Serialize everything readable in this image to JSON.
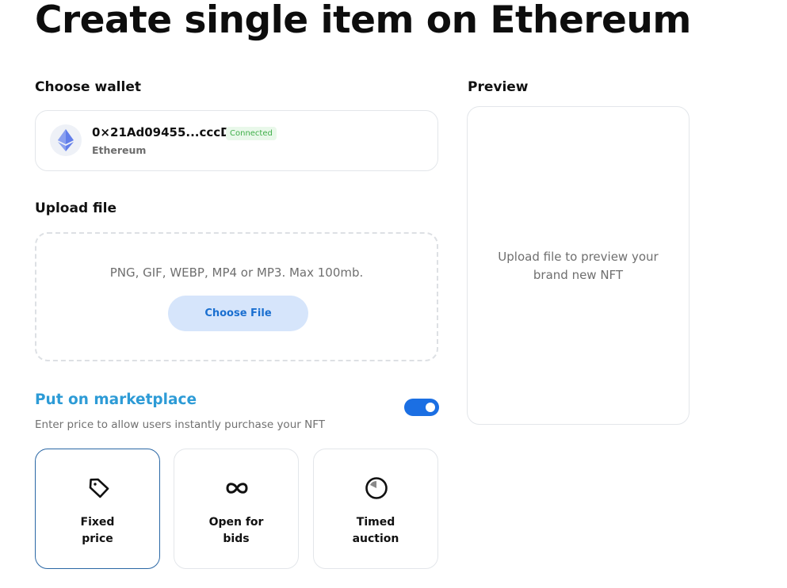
{
  "page": {
    "title": "Create single item on Ethereum"
  },
  "wallet": {
    "label": "Choose wallet",
    "address": "0×21Ad09455...cccD",
    "status": "Connected",
    "network": "Ethereum",
    "icon": "ethereum-icon"
  },
  "upload": {
    "label": "Upload file",
    "hint": "PNG, GIF, WEBP, MP4 or MP3. Max 100mb.",
    "button": "Choose File"
  },
  "marketplace": {
    "title": "Put on marketplace",
    "description": "Enter price to allow users instantly purchase your NFT",
    "enabled": true,
    "options": [
      {
        "line1": "Fixed",
        "line2": "price",
        "icon": "price-tag-icon",
        "selected": true
      },
      {
        "line1": "Open for",
        "line2": "bids",
        "icon": "infinity-icon",
        "selected": false
      },
      {
        "line1": "Timed",
        "line2": "auction",
        "icon": "timer-icon",
        "selected": false
      }
    ]
  },
  "preview": {
    "label": "Preview",
    "line1": "Upload file to preview your",
    "line2": "brand new NFT"
  },
  "colors": {
    "accent": "#1b6fe3",
    "marketplace_title": "#2d9bd6",
    "connected": "#3fae49",
    "selected_border": "#2a67a5"
  }
}
